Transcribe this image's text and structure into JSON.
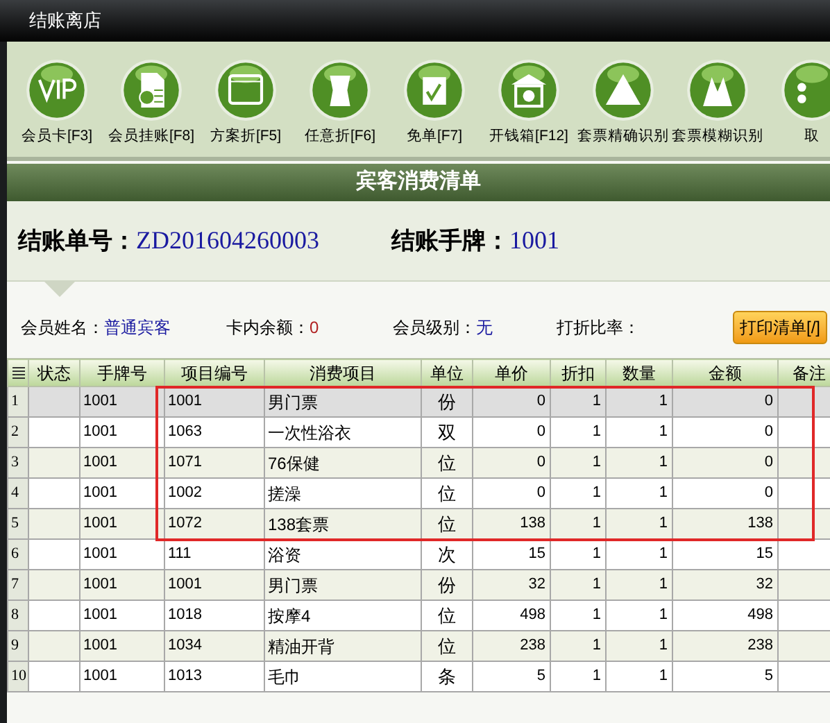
{
  "window": {
    "title": "结账离店"
  },
  "toolbar": [
    {
      "label": "会员卡[F3]"
    },
    {
      "label": "会员挂账[F8]"
    },
    {
      "label": "方案折[F5]"
    },
    {
      "label": "任意折[F6]"
    },
    {
      "label": "免单[F7]"
    },
    {
      "label": "开钱箱[F12]"
    },
    {
      "label": "套票精确识别"
    },
    {
      "label": "套票模糊识别"
    },
    {
      "label": "取"
    }
  ],
  "section_title": "宾客消费清单",
  "bill": {
    "number_label": "结账单号：",
    "number": "ZD201604260003",
    "tag_label": "结账手牌：",
    "tag": "1001"
  },
  "member": [
    {
      "label": "会员姓名：",
      "value": "普通宾客"
    },
    {
      "label": "卡内余额：",
      "value": "0"
    },
    {
      "label": "会员级别：",
      "value": "无"
    },
    {
      "label": "打折比率："
    }
  ],
  "print_button": "打印清单[/]",
  "table": {
    "columns": [
      "状态",
      "手牌号",
      "项目编号",
      "消费项目",
      "单位",
      "单价",
      "折扣",
      "数量",
      "金额",
      "备注"
    ],
    "rows": [
      {
        "index": "1",
        "cells": [
          "",
          "1001",
          "1001",
          "男门票",
          "份",
          "0",
          "1",
          "1",
          "0",
          ""
        ],
        "selected": true
      },
      {
        "index": "2",
        "cells": [
          "",
          "1001",
          "1063",
          "一次性浴衣",
          "双",
          "0",
          "1",
          "1",
          "0",
          ""
        ],
        "selected": false
      },
      {
        "index": "3",
        "cells": [
          "",
          "1001",
          "1071",
          "76保健",
          "位",
          "0",
          "1",
          "1",
          "0",
          ""
        ],
        "selected": false
      },
      {
        "index": "4",
        "cells": [
          "",
          "1001",
          "1002",
          "搓澡",
          "位",
          "0",
          "1",
          "1",
          "0",
          ""
        ],
        "selected": false
      },
      {
        "index": "5",
        "cells": [
          "",
          "1001",
          "1072",
          "138套票",
          "位",
          "138",
          "1",
          "1",
          "138",
          ""
        ],
        "selected": false
      },
      {
        "index": "6",
        "cells": [
          "",
          "1001",
          "111",
          "浴资",
          "次",
          "15",
          "1",
          "1",
          "15",
          ""
        ],
        "selected": false
      },
      {
        "index": "7",
        "cells": [
          "",
          "1001",
          "1001",
          "男门票",
          "份",
          "32",
          "1",
          "1",
          "32",
          ""
        ],
        "selected": false
      },
      {
        "index": "8",
        "cells": [
          "",
          "1001",
          "1018",
          "按摩4",
          "位",
          "498",
          "1",
          "1",
          "498",
          ""
        ],
        "selected": false
      },
      {
        "index": "9",
        "cells": [
          "",
          "1001",
          "1034",
          "精油开背",
          "位",
          "238",
          "1",
          "1",
          "238",
          ""
        ],
        "selected": false
      },
      {
        "index": "10",
        "cells": [
          "",
          "1001",
          "1013",
          "毛巾",
          "条",
          "5",
          "1",
          "1",
          "5",
          ""
        ],
        "selected": false
      }
    ]
  }
}
